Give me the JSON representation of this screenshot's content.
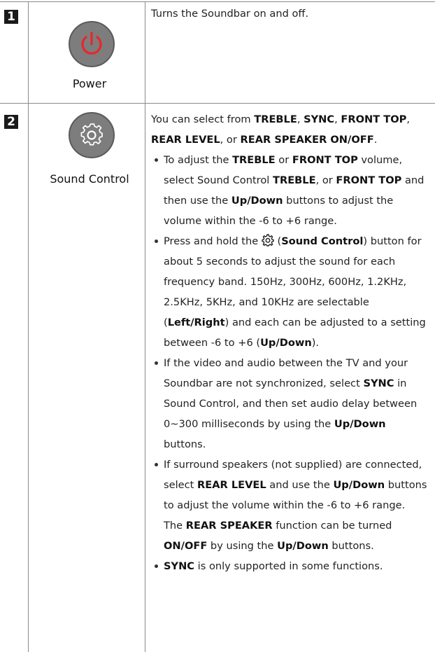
{
  "rows": [
    {
      "number": "1",
      "icon": "power-icon",
      "icon_color": "#e8262a",
      "label": "Power",
      "description": "Turns the Soundbar on and off."
    },
    {
      "number": "2",
      "icon": "gear-icon",
      "label": "Sound Control",
      "intro": [
        "You can select from ",
        "TREBLE",
        ", ",
        "SYNC",
        ", ",
        "FRONT TOP",
        ", ",
        "REAR LEVEL",
        ", or ",
        "REAR SPEAKER ON/OFF",
        "."
      ],
      "bullets": {
        "b1": [
          "To adjust the ",
          "TREBLE",
          " or ",
          "FRONT TOP",
          " volume, select Sound Control ",
          "TREBLE",
          ", or ",
          "FRONT TOP",
          " and then use the ",
          "Up/Down",
          " buttons to adjust the volume within the -6 to +6 range."
        ],
        "b2": [
          "Press and hold the ",
          " (",
          "Sound Control",
          ") button for about 5 seconds to adjust the sound for each frequency band. 150Hz, 300Hz, 600Hz, 1.2KHz, 2.5KHz, 5KHz, and 10KHz are selectable (",
          "Left/Right",
          ") and each can be adjusted to a setting between -6 to +6 (",
          "Up/Down",
          ")."
        ],
        "b3": [
          "If the video and audio between the TV and your Soundbar are not synchronized, select ",
          "SYNC",
          " in Sound Control, and then set audio delay between 0~300 milliseconds by using the ",
          "Up/Down",
          " buttons."
        ],
        "b4": [
          "If surround speakers (not supplied) are connected, select ",
          "REAR LEVEL",
          " and use the ",
          "Up/Down",
          " buttons to adjust the volume within the -6 to +6 range."
        ],
        "b4_extra": [
          "The ",
          "REAR SPEAKER",
          " function can be turned ",
          "ON/OFF",
          " by using the ",
          "Up/Down",
          " buttons."
        ],
        "b5": [
          "SYNC",
          " is only supported in some functions."
        ]
      }
    }
  ]
}
